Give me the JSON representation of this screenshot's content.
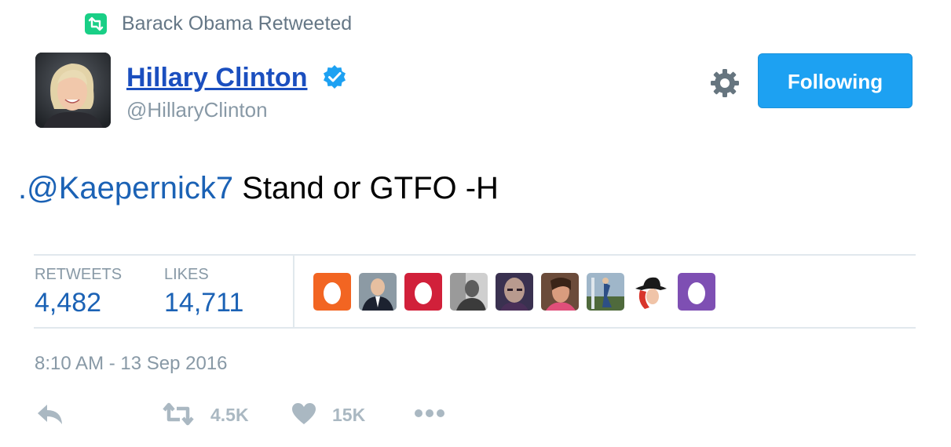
{
  "context": {
    "icon": "retweet-icon",
    "text": "Barack Obama Retweeted",
    "icon_color": "#19cf86"
  },
  "author": {
    "display_name": "Hillary Clinton",
    "handle": "@HillaryClinton",
    "verified": true,
    "verified_color": "#1da1f2"
  },
  "follow_button": {
    "label": "Following",
    "color": "#1da1f2"
  },
  "tweet": {
    "mention": ".@Kaepernick7",
    "body": " Stand or GTFO -H",
    "mention_color": "#1b62b5"
  },
  "stats": {
    "retweets_label": "RETWEETS",
    "retweets_value": "4,482",
    "likes_label": "LIKES",
    "likes_value": "14,711"
  },
  "likers": [
    {
      "kind": "egg",
      "color": "#f26522"
    },
    {
      "kind": "photo-man-suit"
    },
    {
      "kind": "egg",
      "color": "#d1203a"
    },
    {
      "kind": "photo-bw"
    },
    {
      "kind": "photo-bald"
    },
    {
      "kind": "photo-woman"
    },
    {
      "kind": "photo-outdoor"
    },
    {
      "kind": "cartoon-hat"
    },
    {
      "kind": "egg",
      "color": "#7e4fb3"
    }
  ],
  "timestamp": "8:10 AM - 13 Sep 2016",
  "actions": {
    "reply_icon": "reply-icon",
    "retweet_icon": "retweet-icon",
    "retweet_count": "4.5K",
    "like_icon": "heart-icon",
    "like_count": "15K",
    "more_icon": "more-icon"
  }
}
